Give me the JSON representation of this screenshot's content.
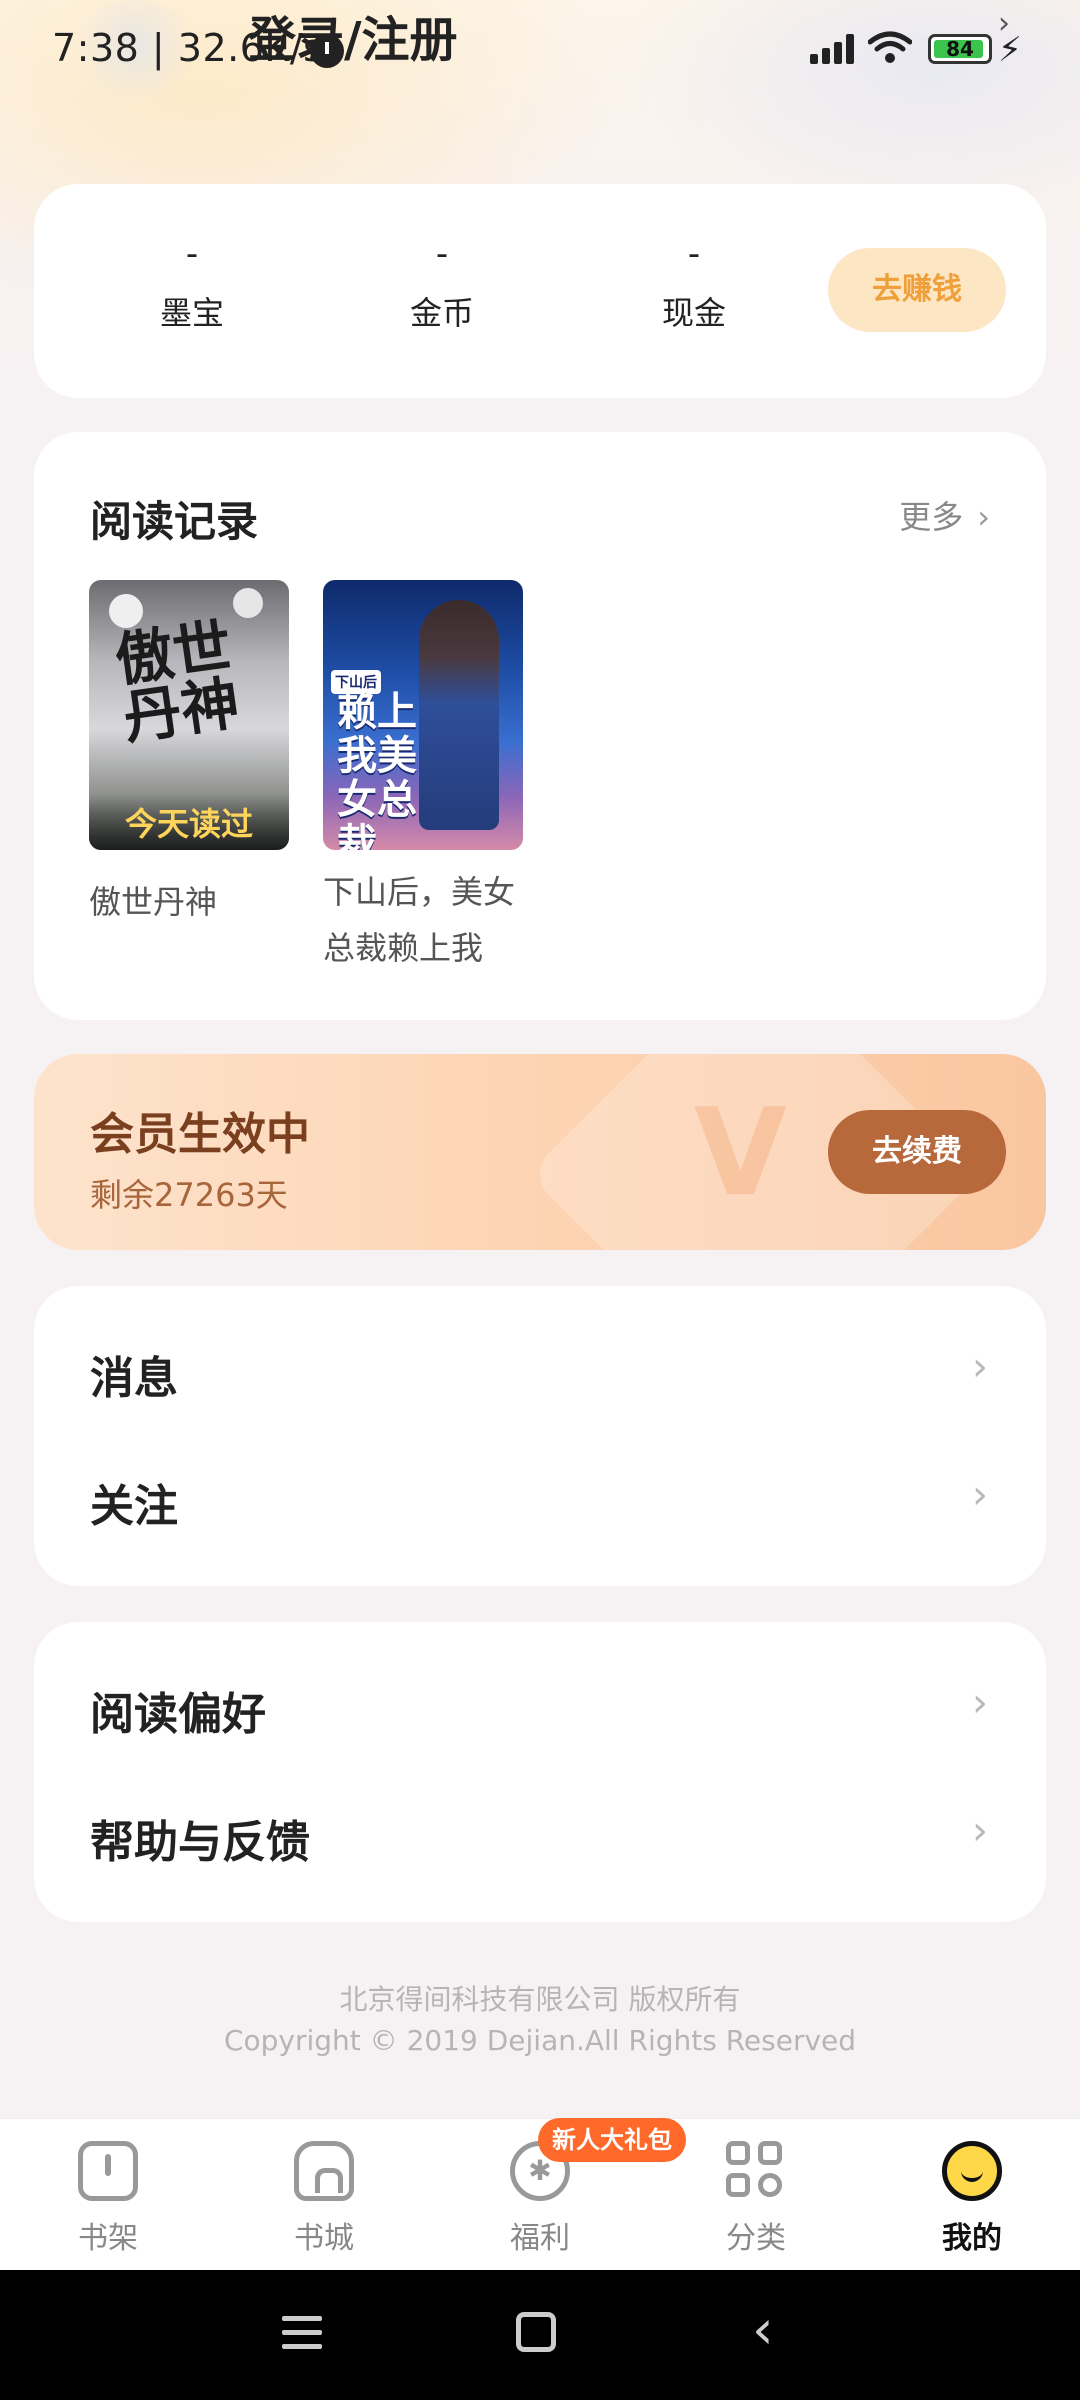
{
  "status_bar": {
    "time": "7:38 | 32.6K/s",
    "login_text": "登录/注册",
    "battery": "84"
  },
  "assets": [
    {
      "value": "-",
      "label": "墨宝"
    },
    {
      "value": "-",
      "label": "金币"
    },
    {
      "value": "-",
      "label": "现金"
    }
  ],
  "earn_button": "去赚钱",
  "reading_history": {
    "title": "阅读记录",
    "more": "更多",
    "books": [
      {
        "title": "傲世丹神",
        "badge": "今天读过",
        "cover_text": "傲世丹神"
      },
      {
        "title_line1": "下山后，美女",
        "title_line2": "总裁赖上我",
        "cover_text": "赖上我美女总裁",
        "cover_tag": "下山后"
      }
    ]
  },
  "vip": {
    "title": "会员生效中",
    "remaining": "剩余27263天",
    "button": "去续费"
  },
  "menu_group_1": [
    "消息",
    "关注"
  ],
  "menu_group_2": [
    "阅读偏好",
    "帮助与反馈"
  ],
  "footer": {
    "company": "北京得间科技有限公司  版权所有",
    "copyright": "Copyright © 2019 Dejian.All Rights Reserved"
  },
  "tabs": [
    {
      "label": "书架",
      "icon": "bookshelf-icon"
    },
    {
      "label": "书城",
      "icon": "bookstore-icon"
    },
    {
      "label": "福利",
      "icon": "welfare-icon"
    },
    {
      "label": "分类",
      "icon": "category-icon"
    },
    {
      "label": "我的",
      "icon": "profile-icon",
      "active": true
    }
  ],
  "gift_badge": "新人大礼包"
}
